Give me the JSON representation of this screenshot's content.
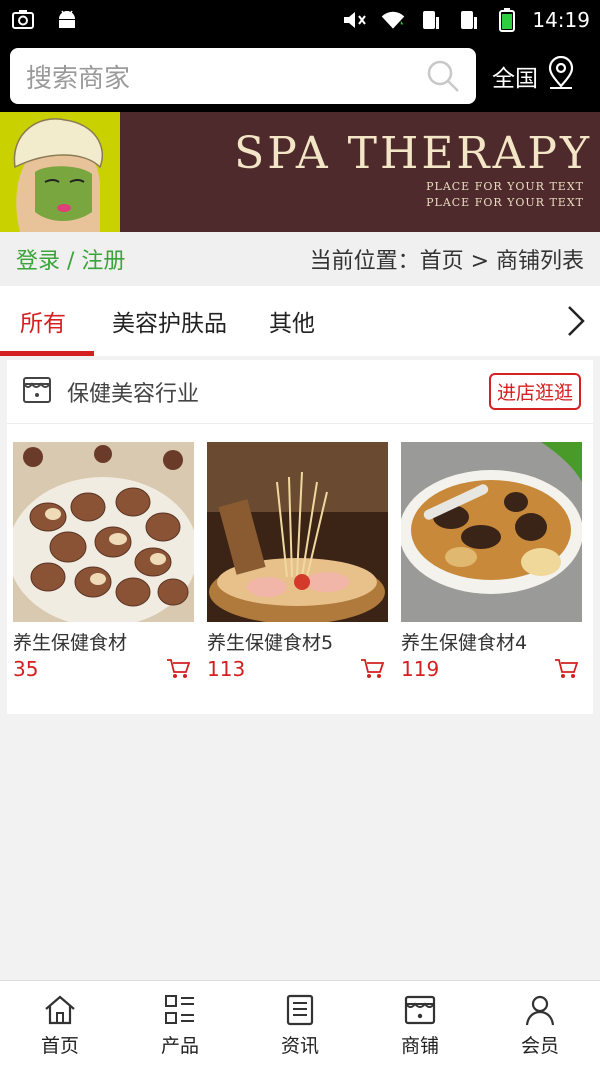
{
  "status_bar": {
    "time": "14:19"
  },
  "search": {
    "placeholder": "搜索商家",
    "region_label": "全国"
  },
  "banner": {
    "title": "SPA  THERAPY",
    "subtitle_line1": "PLACE FOR YOUR TEXT",
    "subtitle_line2": "PLACE FOR YOUR TEXT"
  },
  "info_row": {
    "login_label": "登录 / 注册",
    "breadcrumb": "当前位置：首页 > 商铺列表"
  },
  "tabs": [
    {
      "label": "所有",
      "active": true
    },
    {
      "label": "美容护肤品",
      "active": false
    },
    {
      "label": "其他",
      "active": false
    }
  ],
  "shop": {
    "name": "保健美容行业",
    "visit_label": "进店逛逛",
    "products": [
      {
        "name": "养生保健食材",
        "price": "35"
      },
      {
        "name": "养生保健食材5",
        "price": "113"
      },
      {
        "name": "养生保健食材4",
        "price": "119"
      }
    ]
  },
  "bottom_nav": [
    {
      "label": "首页",
      "icon": "home-icon"
    },
    {
      "label": "产品",
      "icon": "product-list-icon"
    },
    {
      "label": "资讯",
      "icon": "news-icon"
    },
    {
      "label": "商铺",
      "icon": "shop-icon"
    },
    {
      "label": "会员",
      "icon": "user-icon"
    }
  ],
  "colors": {
    "accent_red": "#d42020",
    "login_green": "#3aa33a",
    "banner_bg": "#4e2a2c"
  }
}
